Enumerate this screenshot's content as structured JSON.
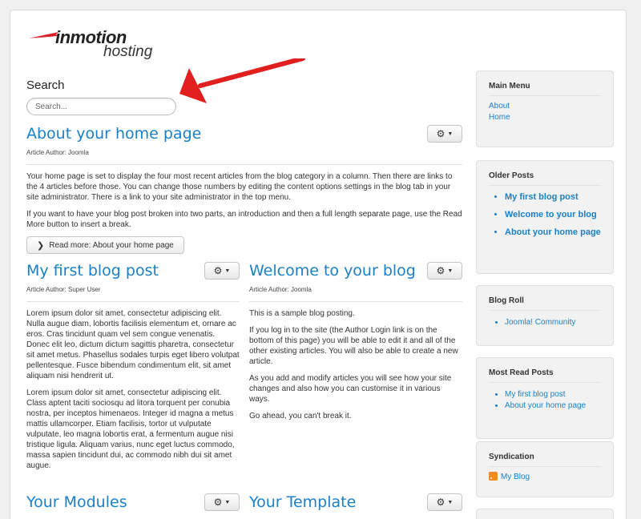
{
  "logo": {
    "text_main": "inmotion",
    "text_sub": "hosting"
  },
  "search": {
    "title": "Search",
    "placeholder": "Search..."
  },
  "articles": {
    "home": {
      "title": "About your home page",
      "meta": "Article Author: Joomla",
      "paragraphs": [
        "Your home page is set to display the four most recent articles from the blog category in a column. Then there are links to the 4 articles before those. You can change those numbers by editing the content options settings in the blog tab in your site administrator. There is a link to your site administrator in the top menu.",
        "If you want to have your blog post broken into two parts, an introduction and then a full length separate page, use the Read More button to insert a break."
      ],
      "readmore": "Read more: About your home page"
    },
    "first": {
      "title": "My first blog post",
      "meta": "Article Author: Super User",
      "paragraphs": [
        "Lorem ipsum dolor sit amet, consectetur adipiscing elit. Nulla augue diam, lobortis facilisis elementum et, ornare ac eros. Cras tincidunt quam vel sem congue venenatis. Donec elit leo, dictum dictum sagittis pharetra, consectetur sit amet metus. Phasellus sodales turpis eget libero volutpat pellentesque. Fusce bibendum condimentum elit, sit amet aliquam nisi hendrerit ut.",
        "Lorem ipsum dolor sit amet, consectetur adipiscing elit. Class aptent taciti sociosqu ad litora torquent per conubia nostra, per inceptos himenaeos. Integer id magna a metus mattis ullamcorper. Etiam facilisis, tortor ut vulputate vulputate, leo magna lobortis erat, a fermentum augue nisi tristique ligula. Aliquam varius, nunc eget luctus commodo, massa sapien tincidunt dui, ac commodo nibh dui sit amet augue."
      ]
    },
    "welcome": {
      "title": "Welcome to your blog",
      "meta": "Article Author: Joomla",
      "paragraphs": [
        "This is a sample blog posting.",
        "If you log in to the site (the Author Login link is on the bottom of this page) you will be able to edit it and all of the other existing articles. You will also be able to create a new article.",
        "As you add and modify articles you will see how your site changes and also how you can customise it in various ways.",
        "Go ahead, you can't break it."
      ]
    },
    "modules": {
      "title": "Your Modules"
    },
    "template": {
      "title": "Your Template"
    }
  },
  "icons": {
    "gear": "gear-icon",
    "caret": "caret-down-icon",
    "chevron": "chevron-right-icon",
    "rss": "rss-icon"
  },
  "sidebar": {
    "main_menu": {
      "title": "Main Menu",
      "items": [
        "About",
        "Home"
      ]
    },
    "older_posts": {
      "title": "Older Posts",
      "items": [
        "My first blog post",
        "Welcome to your blog",
        "About your home page"
      ]
    },
    "blog_roll": {
      "title": "Blog Roll",
      "items": [
        "Joomla! Community"
      ]
    },
    "most_read": {
      "title": "Most Read Posts",
      "items": [
        "My first blog post",
        "About your home page"
      ]
    },
    "syndication": {
      "title": "Syndication",
      "link": "My Blog"
    }
  },
  "colors": {
    "link": "#1a80c7",
    "arrow": "#e21f1f",
    "panel_bg": "#f2f2f2"
  }
}
